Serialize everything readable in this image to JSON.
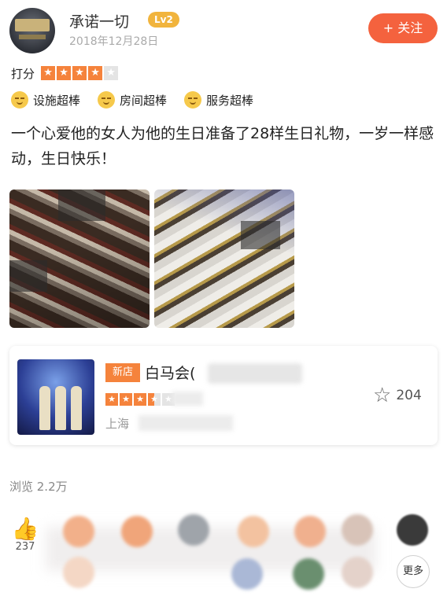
{
  "user": {
    "name": "承诺一切",
    "level": "Lv2",
    "date": "2018年12月28日",
    "follow_label": "+ 关注"
  },
  "rating": {
    "label": "打分",
    "stars": 4,
    "max": 5,
    "star_glyph": "★"
  },
  "tags": [
    {
      "icon": "smile-icon",
      "label": "设施超棒"
    },
    {
      "icon": "smile-icon",
      "label": "房间超棒"
    },
    {
      "icon": "smile-icon",
      "label": "服务超棒"
    }
  ],
  "review_text": "一个心爱他的女人为他的生日准备了28样生日礼物，一岁一样感动，生日快乐！",
  "shop": {
    "badge": "新店",
    "name": "白马会(",
    "stars": 3.5,
    "location": "上海",
    "favorite_count": "204"
  },
  "views": "浏览 2.2万",
  "likes": {
    "count": "237",
    "more_label": "更多"
  },
  "colors": {
    "accent": "#f4623e",
    "star": "#f5833c",
    "level_badge": "#f1b43d"
  }
}
